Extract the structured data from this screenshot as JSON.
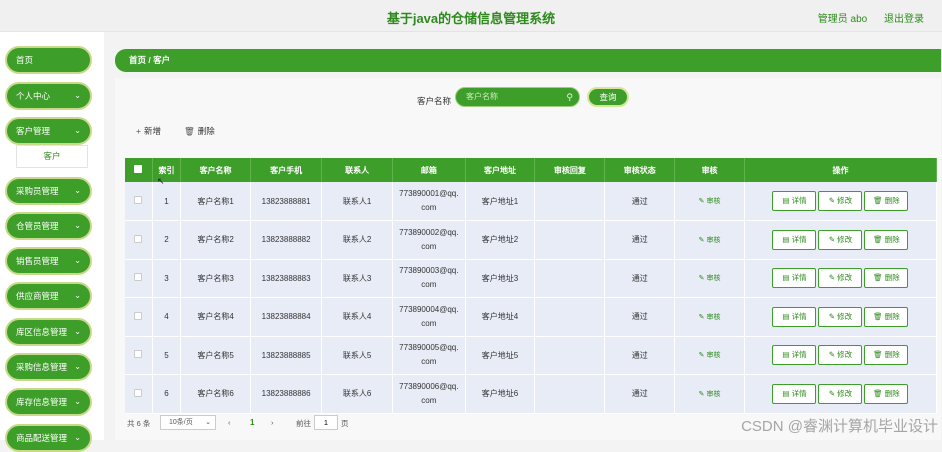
{
  "header": {
    "title": "基于java的仓储信息管理系统",
    "user": "管理员 abo",
    "logout": "退出登录"
  },
  "sidebar": {
    "items": [
      {
        "label": "首页",
        "chevron": false
      },
      {
        "label": "个人中心",
        "chevron": true
      },
      {
        "label": "客户管理",
        "chevron": true
      },
      {
        "label": "采购员管理",
        "chevron": true
      },
      {
        "label": "仓管员管理",
        "chevron": true
      },
      {
        "label": "销售员管理",
        "chevron": true
      },
      {
        "label": "供应商管理",
        "chevron": true
      },
      {
        "label": "库区信息管理",
        "chevron": true
      },
      {
        "label": "采购信息管理",
        "chevron": true
      },
      {
        "label": "库存信息管理",
        "chevron": true
      },
      {
        "label": "商品配送管理",
        "chevron": true
      }
    ],
    "sub_item": "客户"
  },
  "breadcrumb": "首页 / 客户",
  "search": {
    "label": "客户名称",
    "placeholder": "客户名称",
    "button": "查询"
  },
  "actions": {
    "add": "新增",
    "delete": "删除"
  },
  "table": {
    "headers": [
      "索引",
      "客户名称",
      "客户手机",
      "联系人",
      "邮箱",
      "客户地址",
      "审核回复",
      "审核状态",
      "审核",
      "操作"
    ],
    "rows": [
      {
        "idx": "1",
        "name": "客户名称1",
        "phone": "13823888881",
        "contact": "联系人1",
        "email1": "773890001@qq.",
        "email2": "com",
        "addr": "客户地址1",
        "reply": "",
        "status": "通过",
        "audit": "审核"
      },
      {
        "idx": "2",
        "name": "客户名称2",
        "phone": "13823888882",
        "contact": "联系人2",
        "email1": "773890002@qq.",
        "email2": "com",
        "addr": "客户地址2",
        "reply": "",
        "status": "通过",
        "audit": "审核"
      },
      {
        "idx": "3",
        "name": "客户名称3",
        "phone": "13823888883",
        "contact": "联系人3",
        "email1": "773890003@qq.",
        "email2": "com",
        "addr": "客户地址3",
        "reply": "",
        "status": "通过",
        "audit": "审核"
      },
      {
        "idx": "4",
        "name": "客户名称4",
        "phone": "13823888884",
        "contact": "联系人4",
        "email1": "773890004@qq.",
        "email2": "com",
        "addr": "客户地址4",
        "reply": "",
        "status": "通过",
        "audit": "审核"
      },
      {
        "idx": "5",
        "name": "客户名称5",
        "phone": "13823888885",
        "contact": "联系人5",
        "email1": "773890005@qq.",
        "email2": "com",
        "addr": "客户地址5",
        "reply": "",
        "status": "通过",
        "audit": "审核"
      },
      {
        "idx": "6",
        "name": "客户名称6",
        "phone": "13823888886",
        "contact": "联系人6",
        "email1": "773890006@qq.",
        "email2": "com",
        "addr": "客户地址6",
        "reply": "",
        "status": "通过",
        "audit": "审核"
      }
    ],
    "ops": {
      "detail": "详情",
      "edit": "修改",
      "delete": "删除"
    }
  },
  "pager": {
    "total": "共 6 条",
    "page_size": "10条/页",
    "current": "1",
    "goto": "前往",
    "goto_value": "1",
    "page_unit": "页"
  },
  "watermark": "CSDN @睿渊计算机毕业设计",
  "colors": {
    "primary": "#3e9e2a",
    "sidebar_border": "#c9d98a",
    "row_bg": "#e7ecf6"
  }
}
